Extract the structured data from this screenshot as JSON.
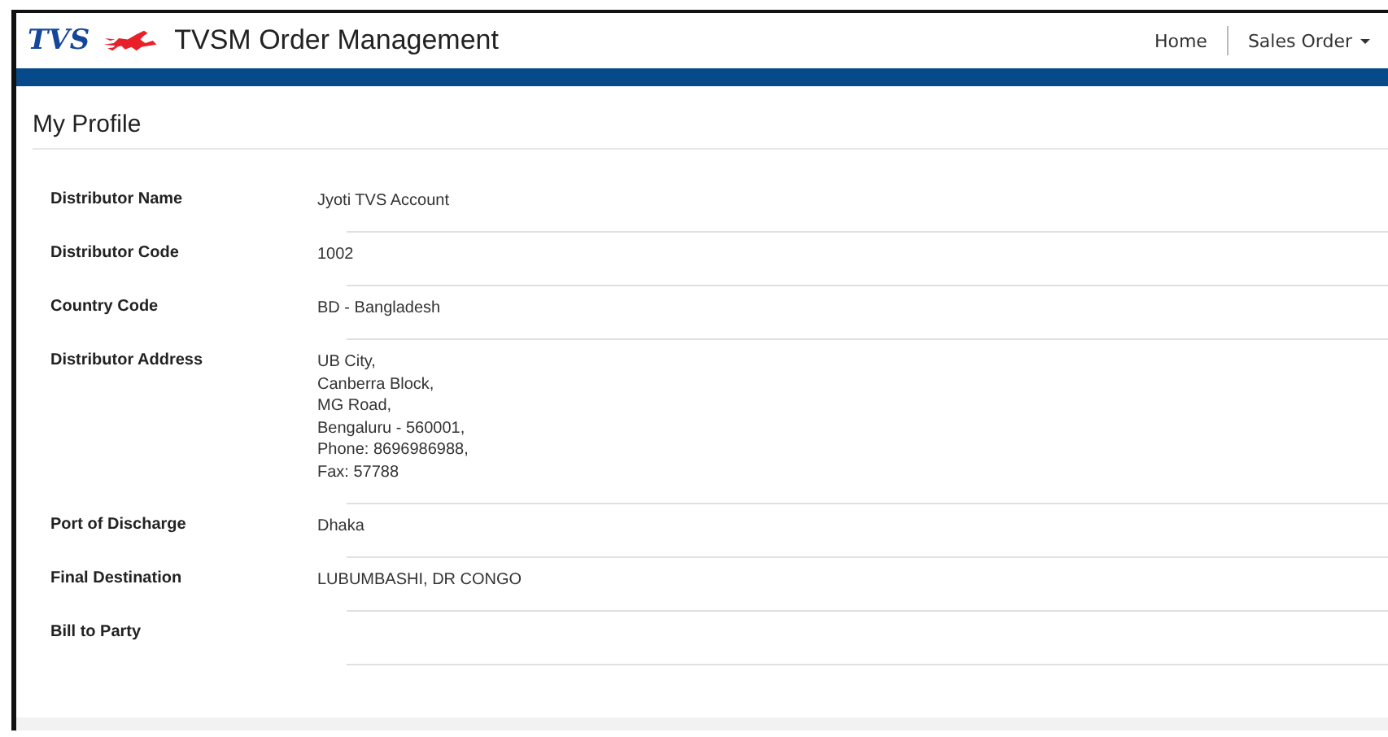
{
  "header": {
    "logo_text": "TVS",
    "title": "TVSM Order Management",
    "nav": [
      {
        "label": "Home",
        "dropdown": false
      },
      {
        "label": "Sales Order",
        "dropdown": true
      }
    ]
  },
  "page_title": "My Profile",
  "fields": [
    {
      "label": "Distributor Name",
      "lines": [
        "Jyoti TVS Account"
      ]
    },
    {
      "label": "Distributor Code",
      "lines": [
        "1002"
      ]
    },
    {
      "label": "Country Code",
      "lines": [
        "BD - Bangladesh"
      ]
    },
    {
      "label": "Distributor Address",
      "lines": [
        "UB City,",
        "Canberra Block,",
        "MG Road,",
        "Bengaluru - 560001,",
        "Phone: 8696986988,",
        "Fax: 57788"
      ]
    },
    {
      "label": "Port of Discharge",
      "lines": [
        "Dhaka"
      ]
    },
    {
      "label": "Final Destination",
      "lines": [
        "LUBUMBASHI, DR CONGO"
      ]
    },
    {
      "label": "Bill to Party"
    }
  ]
}
